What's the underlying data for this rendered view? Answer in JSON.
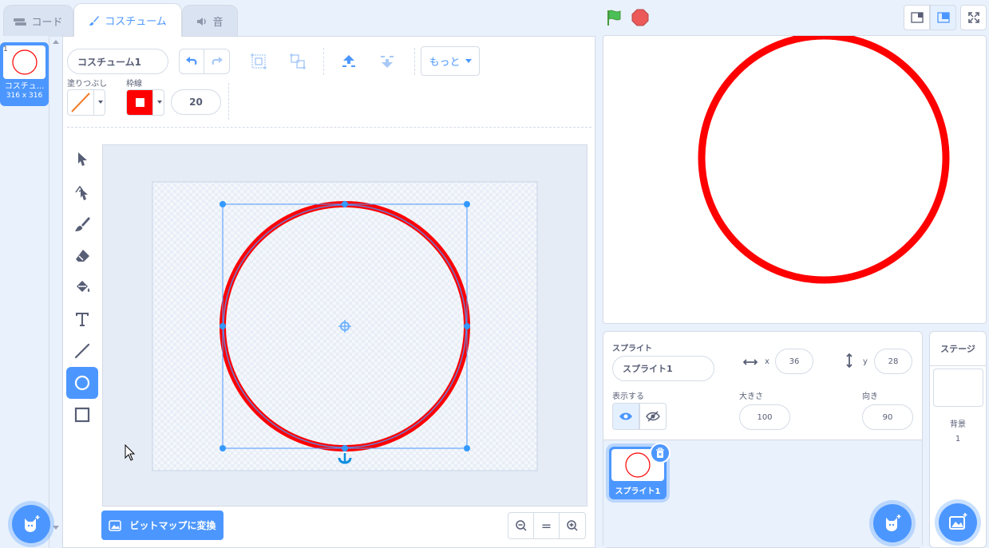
{
  "tabs": [
    {
      "label": "コード",
      "icon": "code-icon"
    },
    {
      "label": "コスチューム",
      "icon": "brush-icon"
    },
    {
      "label": "音",
      "icon": "speaker-icon"
    }
  ],
  "costume_list": {
    "items": [
      {
        "index": "1",
        "name": "コスチュ...",
        "size": "316 x 316"
      }
    ]
  },
  "editor": {
    "costume_name": "コスチューム1",
    "more_label": "もっと",
    "fill_label": "塗りつぶし",
    "outline_label": "枠線",
    "outline_width": "20",
    "convert_label": "ビットマップに変換",
    "zoom_reset": "="
  },
  "tools": [
    "select-tool",
    "reshape-tool",
    "brush-tool",
    "eraser-tool",
    "fill-tool",
    "text-tool",
    "line-tool",
    "circle-tool",
    "rectangle-tool"
  ],
  "sprite": {
    "section_label": "スプライト",
    "name": "スプライト1",
    "x_label": "x",
    "x": "36",
    "y_label": "y",
    "y": "28",
    "show_label": "表示する",
    "size_label": "大きさ",
    "size": "100",
    "direction_label": "向き",
    "direction": "90",
    "tile_name": "スプライト1"
  },
  "stage_panel": {
    "title": "ステージ",
    "backdrop_label": "背景",
    "backdrop_count": "1"
  },
  "colors": {
    "accent": "#4c97ff",
    "outline_color": "#ff0000",
    "go_flag": "#4cbf56",
    "stop": "#ec5959"
  }
}
